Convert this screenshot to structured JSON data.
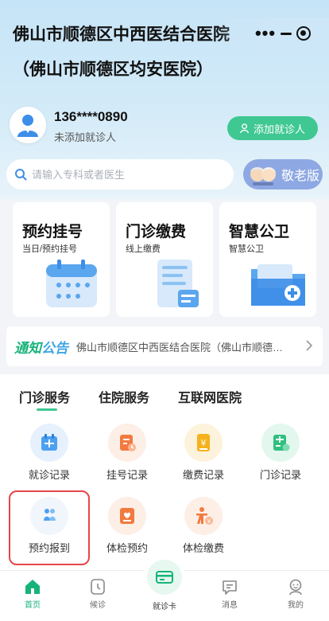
{
  "header": {
    "title": "佛山市顺德区中西医结合医院（佛山市顺德区均安医院）",
    "capsule": {
      "more_label": "•••"
    }
  },
  "user": {
    "phone": "136****0890",
    "status": "未添加就诊人",
    "add_button": "添加就诊人"
  },
  "search": {
    "placeholder": "请输入专科或者医生"
  },
  "elder_mode": {
    "label": "敬老版"
  },
  "cards": [
    {
      "title": "预约挂号",
      "subtitle": "当日/预约挂号"
    },
    {
      "title": "门诊缴费",
      "subtitle": "线上缴费"
    },
    {
      "title": "智慧公卫",
      "subtitle": "智慧公卫"
    }
  ],
  "notice": {
    "tag_part1": "通知",
    "tag_part2": "公告",
    "text": "佛山市顺德区中西医结合医院（佛山市顺德区均安医院）"
  },
  "services": {
    "tabs": [
      "门诊服务",
      "住院服务",
      "互联网医院"
    ],
    "active_tab": "门诊服务",
    "items": [
      {
        "label": "就诊记录",
        "icon": "calendar-icon"
      },
      {
        "label": "挂号记录",
        "icon": "register-record-icon"
      },
      {
        "label": "缴费记录",
        "icon": "payment-record-icon"
      },
      {
        "label": "门诊记录",
        "icon": "outpatient-record-icon"
      },
      {
        "label": "预约报到",
        "icon": "check-in-icon"
      },
      {
        "label": "体检预约",
        "icon": "checkup-booking-icon"
      },
      {
        "label": "体检缴费",
        "icon": "checkup-payment-icon"
      }
    ]
  },
  "tabbar": {
    "items": [
      {
        "label": "首页",
        "icon": "home-icon"
      },
      {
        "label": "候诊",
        "icon": "clock-icon"
      },
      {
        "label": "就诊卡",
        "icon": "card-icon"
      },
      {
        "label": "消息",
        "icon": "message-icon"
      },
      {
        "label": "我的",
        "icon": "profile-icon"
      }
    ],
    "active": "首页"
  },
  "colors": {
    "accent_green": "#3fc892",
    "notice_green": "#17b37a",
    "notice_blue": "#3da5e6",
    "elder_blue": "#8ea8e3",
    "highlight_red": "#e6454a"
  }
}
